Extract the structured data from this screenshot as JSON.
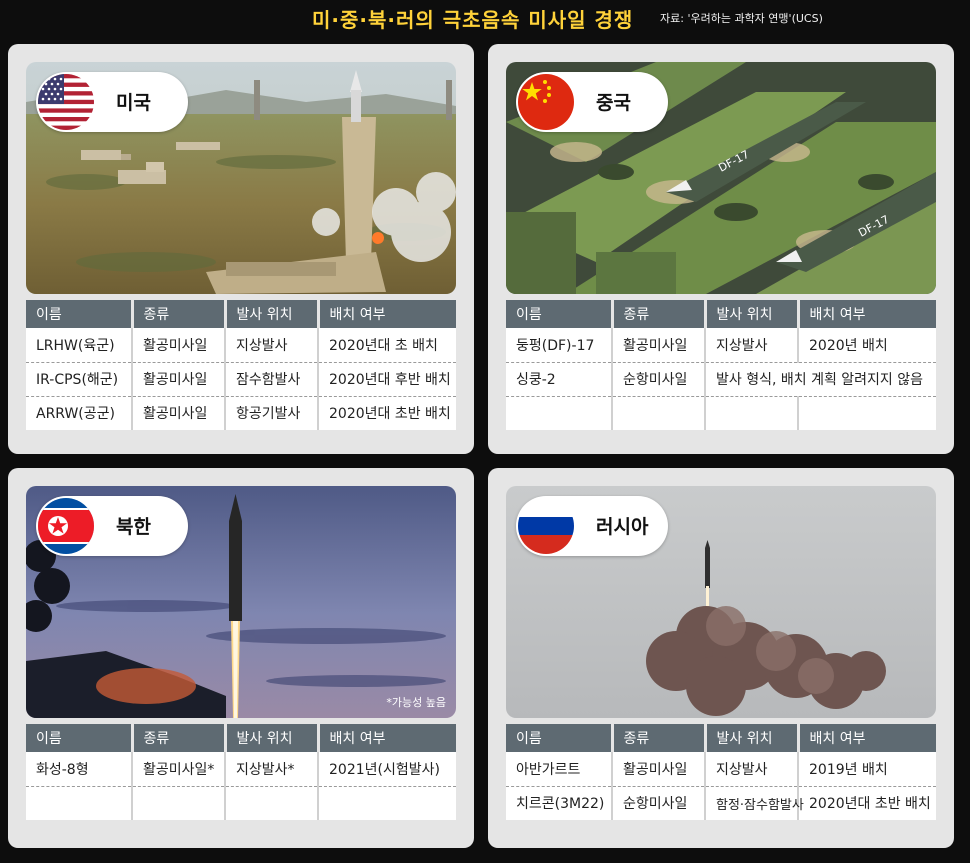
{
  "header": {
    "title": "미·중·북·러의 극초음속 미사일 경쟁",
    "source": "자료: '우려하는 과학자 연맹'(UCS)"
  },
  "columns": [
    "이름",
    "종류",
    "발사 위치",
    "배치 여부"
  ],
  "colors": {
    "header_cell": "#5e6a72",
    "title": "#ffd23a",
    "card": "#e5e5e5"
  },
  "cards": {
    "us": {
      "country": "미국",
      "flag_icon": "us-flag-icon",
      "rows": [
        [
          "LRHW(육군)",
          "활공미사일",
          "지상발사",
          "2020년대 초 배치"
        ],
        [
          "IR-CPS(해군)",
          "활공미사일",
          "잠수함발사",
          "2020년대 후반 배치"
        ],
        [
          "ARRW(공군)",
          "활공미사일",
          "항공기발사",
          "2020년대 초반 배치"
        ]
      ]
    },
    "cn": {
      "country": "중국",
      "flag_icon": "china-flag-icon",
      "photo_labels": [
        "DF-17",
        "DF-17"
      ],
      "rows": [
        [
          "둥펑(DF)-17",
          "활공미사일",
          "지상발사",
          "2020년 배치"
        ],
        [
          "싱쿵-2",
          "순항미사일",
          "발사 형식, 배치 계획 알려지지 않음"
        ]
      ]
    },
    "nk": {
      "country": "북한",
      "flag_icon": "north-korea-flag-icon",
      "note": "*가능성 높음",
      "rows": [
        [
          "화성-8형",
          "활공미사일*",
          "지상발사*",
          "2021년(시험발사)"
        ]
      ]
    },
    "ru": {
      "country": "러시아",
      "flag_icon": "russia-flag-icon",
      "rows": [
        [
          "아반가르트",
          "활공미사일",
          "지상발사",
          "2019년 배치"
        ],
        [
          "치르콘(3M22)",
          "순항미사일",
          "함정·잠수함발사",
          "2020년대 초반 배치"
        ]
      ]
    }
  }
}
